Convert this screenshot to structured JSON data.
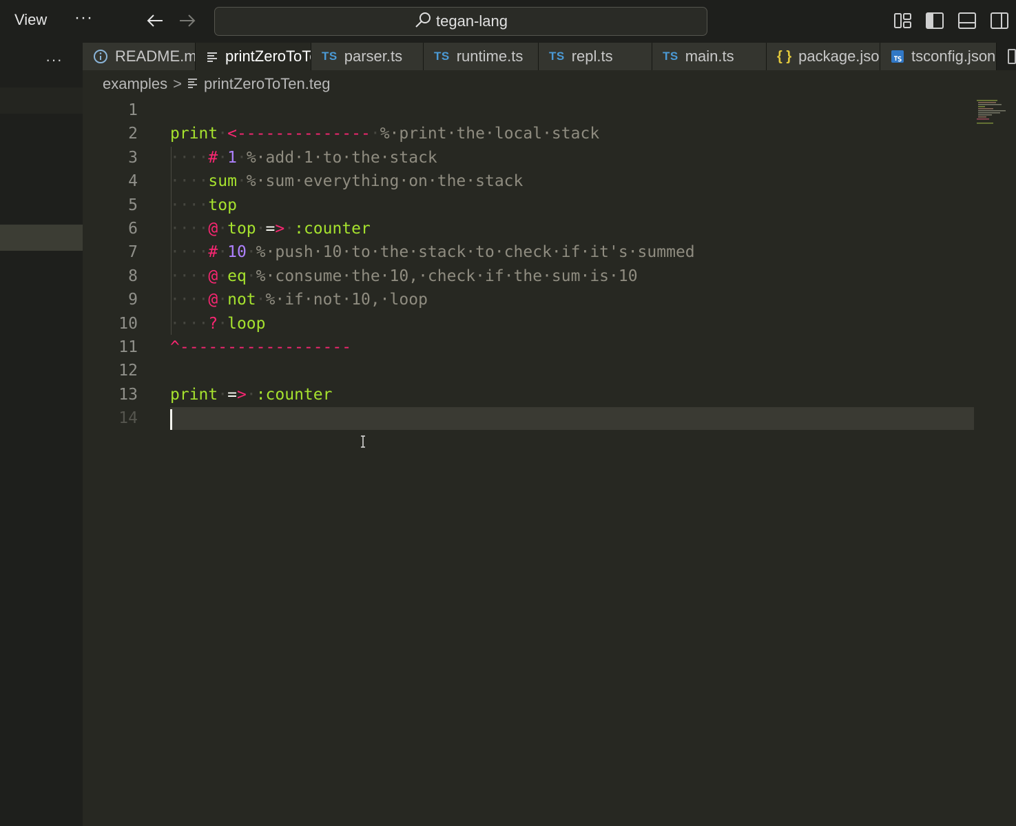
{
  "titlebar": {
    "menu_view": "View",
    "menu_more": "···",
    "search_label": "tegan-lang"
  },
  "sidebar": {
    "more_label": "···"
  },
  "tabs": [
    {
      "label": "README.md",
      "icon": "info-icon",
      "active": false
    },
    {
      "label": "printZeroToTen.teg",
      "icon": "lines-icon",
      "active": true
    },
    {
      "label": "parser.ts",
      "icon": "ts-icon",
      "active": false
    },
    {
      "label": "runtime.ts",
      "icon": "ts-icon",
      "active": false
    },
    {
      "label": "repl.ts",
      "icon": "ts-icon",
      "active": false
    },
    {
      "label": "main.ts",
      "icon": "ts-icon",
      "active": false
    },
    {
      "label": "package.json",
      "icon": "json-icon",
      "active": false
    },
    {
      "label": "tsconfig.json",
      "icon": "tsconfig-icon",
      "active": false
    }
  ],
  "tab_icon_text": {
    "ts": "TS",
    "json": "{ }"
  },
  "breadcrumb": {
    "folder": "examples",
    "separator": ">",
    "file": "printZeroToTen.teg"
  },
  "editor": {
    "line_numbers": [
      "1",
      "2",
      "3",
      "4",
      "5",
      "6",
      "7",
      "8",
      "9",
      "10",
      "11",
      "12",
      "13",
      "14"
    ],
    "active_line": 14,
    "lines": [
      [],
      [
        {
          "t": "print",
          "c": "kw"
        },
        {
          "t": "·",
          "c": "ws"
        },
        {
          "t": "<--------------",
          "c": "op"
        },
        {
          "t": "·",
          "c": "ws"
        },
        {
          "t": "%·print·the·local·stack",
          "c": "cm"
        }
      ],
      [
        {
          "t": "····",
          "c": "ws"
        },
        {
          "t": "#",
          "c": "op"
        },
        {
          "t": "·",
          "c": "ws"
        },
        {
          "t": "1",
          "c": "num"
        },
        {
          "t": "·",
          "c": "ws"
        },
        {
          "t": "%·add·1·to·the·stack",
          "c": "cm"
        }
      ],
      [
        {
          "t": "····",
          "c": "ws"
        },
        {
          "t": "sum",
          "c": "kw"
        },
        {
          "t": "·",
          "c": "ws"
        },
        {
          "t": "%·sum·everything·on·the·stack",
          "c": "cm"
        }
      ],
      [
        {
          "t": "····",
          "c": "ws"
        },
        {
          "t": "top",
          "c": "kw"
        }
      ],
      [
        {
          "t": "····",
          "c": "ws"
        },
        {
          "t": "@",
          "c": "op"
        },
        {
          "t": "·",
          "c": "ws"
        },
        {
          "t": "top",
          "c": "kw"
        },
        {
          "t": "·",
          "c": "ws"
        },
        {
          "t": "=",
          "c": "wt"
        },
        {
          "t": ">",
          "c": "op"
        },
        {
          "t": "·",
          "c": "ws"
        },
        {
          "t": ":counter",
          "c": "sym"
        }
      ],
      [
        {
          "t": "····",
          "c": "ws"
        },
        {
          "t": "#",
          "c": "op"
        },
        {
          "t": "·",
          "c": "ws"
        },
        {
          "t": "10",
          "c": "num"
        },
        {
          "t": "·",
          "c": "ws"
        },
        {
          "t": "%·push·10·to·the·stack·to·check·if·it's·summed",
          "c": "cm"
        }
      ],
      [
        {
          "t": "····",
          "c": "ws"
        },
        {
          "t": "@",
          "c": "op"
        },
        {
          "t": "·",
          "c": "ws"
        },
        {
          "t": "eq",
          "c": "kw"
        },
        {
          "t": "·",
          "c": "ws"
        },
        {
          "t": "%·consume·the·10,·check·if·the·sum·is·10",
          "c": "cm"
        }
      ],
      [
        {
          "t": "····",
          "c": "ws"
        },
        {
          "t": "@",
          "c": "op"
        },
        {
          "t": "·",
          "c": "ws"
        },
        {
          "t": "not",
          "c": "kw"
        },
        {
          "t": "·",
          "c": "ws"
        },
        {
          "t": "%·if·not·10,·loop",
          "c": "cm"
        }
      ],
      [
        {
          "t": "····",
          "c": "ws"
        },
        {
          "t": "?",
          "c": "op"
        },
        {
          "t": "·",
          "c": "ws"
        },
        {
          "t": "loop",
          "c": "kw"
        }
      ],
      [
        {
          "t": "^------------------",
          "c": "op"
        }
      ],
      [],
      [
        {
          "t": "print",
          "c": "kw"
        },
        {
          "t": "·",
          "c": "ws"
        },
        {
          "t": "=",
          "c": "wt"
        },
        {
          "t": ">",
          "c": "op"
        },
        {
          "t": "·",
          "c": "ws"
        },
        {
          "t": ":counter",
          "c": "sym"
        }
      ],
      []
    ]
  },
  "colors": {
    "keyword": "#a6e22e",
    "operator": "#f92672",
    "number": "#ae81ff",
    "comment": "#8f8c80",
    "background": "#272822"
  }
}
